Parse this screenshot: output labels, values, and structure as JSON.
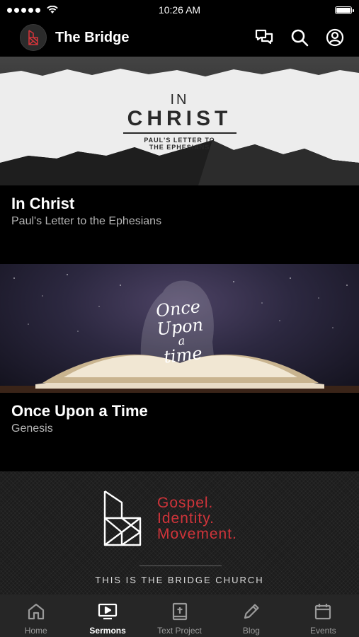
{
  "status_bar": {
    "time": "10:26 AM",
    "signal_dots": 5,
    "battery_level": 1.0
  },
  "header": {
    "title": "The Bridge",
    "icons": [
      "chat-icon",
      "search-icon",
      "profile-icon"
    ]
  },
  "sermon_series": [
    {
      "title": "In Christ",
      "subtitle": "Paul's Letter to the Ephesians",
      "banner": {
        "line1": "IN",
        "line2": "CHRIST",
        "line3": "PAUL'S LETTER TO",
        "line4": "THE EPHESIANS"
      }
    },
    {
      "title": "Once Upon a Time",
      "subtitle": "Genesis",
      "banner": {
        "script_1": "Once",
        "script_2": "Upon",
        "script_3": "a",
        "script_4": "time"
      }
    }
  ],
  "brand": {
    "tagline_1": "Gospel.",
    "tagline_2": "Identity.",
    "tagline_3": "Movement.",
    "footer": "THIS IS THE BRIDGE CHURCH",
    "accent_color": "#d0343a"
  },
  "tabs": [
    {
      "label": "Home",
      "icon": "home-icon",
      "active": false
    },
    {
      "label": "Sermons",
      "icon": "tv-icon",
      "active": true
    },
    {
      "label": "Text Project",
      "icon": "bible-icon",
      "active": false
    },
    {
      "label": "Blog",
      "icon": "pencil-icon",
      "active": false
    },
    {
      "label": "Events",
      "icon": "calendar-icon",
      "active": false
    }
  ]
}
